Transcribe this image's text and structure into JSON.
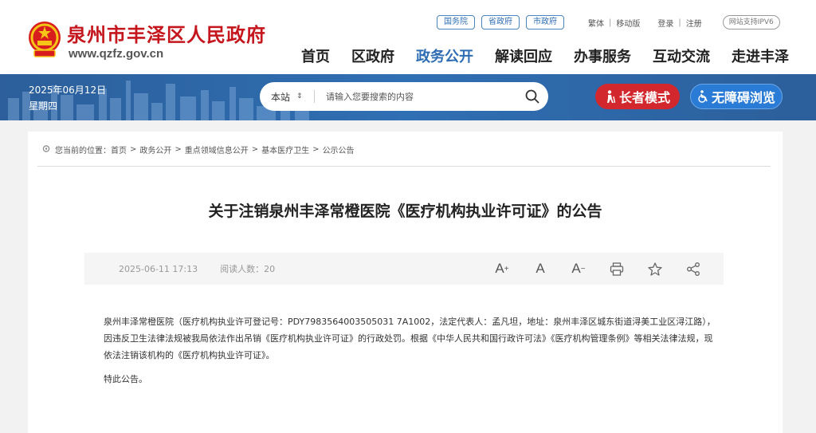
{
  "header": {
    "site_title": "泉州市丰泽区人民政府",
    "site_url": "www.qzfz.gov.cn",
    "top_links": {
      "gov_links": [
        "国务院",
        "省政府",
        "市政府"
      ],
      "traditional": "繁体",
      "mobile": "移动版",
      "login": "登录",
      "register": "注册",
      "ipv6": "网站支持IPV6"
    },
    "nav": [
      "首页",
      "区政府",
      "政务公开",
      "解读回应",
      "办事服务",
      "互动交流",
      "走进丰泽"
    ],
    "nav_active": "政务公开"
  },
  "band": {
    "date": "2025年06月12日",
    "weekday": "星期四",
    "search": {
      "scope": "本站",
      "placeholder": "请输入您要搜索的内容"
    },
    "elder_mode": "长者模式",
    "accessible": "无障碍浏览"
  },
  "breadcrumb": {
    "prefix": "您当前的位置：",
    "items": [
      "首页",
      "政务公开",
      "重点领域信息公开",
      "基本医疗卫生",
      "公示公告"
    ]
  },
  "article": {
    "title": "关于注销泉州丰泽常橙医院《医疗机构执业许可证》的公告",
    "date": "2025-06-11 17:13",
    "views": "阅读人数：20",
    "tools": [
      "A+",
      "A",
      "A-",
      "print-icon",
      "star-icon",
      "share-icon"
    ],
    "paragraph1": "泉州丰泽常橙医院（医疗机构执业许可登记号：PDY7983564003505031 7A1002，法定代表人：孟凡坦，地址：泉州丰泽区城东街道浔美工业区浔江路），因违反卫生法律法规被我局依法作出吊销《医疗机构执业许可证》的行政处罚。根据《中华人民共和国行政许可法》《医疗机构管理条例》等相关法律法规，现依法注销该机构的《医疗机构执业许可证》。",
    "paragraph2": "特此公告。"
  },
  "colors": {
    "brand_red": "#c4161c",
    "brand_blue": "#2e6db4",
    "elder_red": "#d2282d"
  }
}
